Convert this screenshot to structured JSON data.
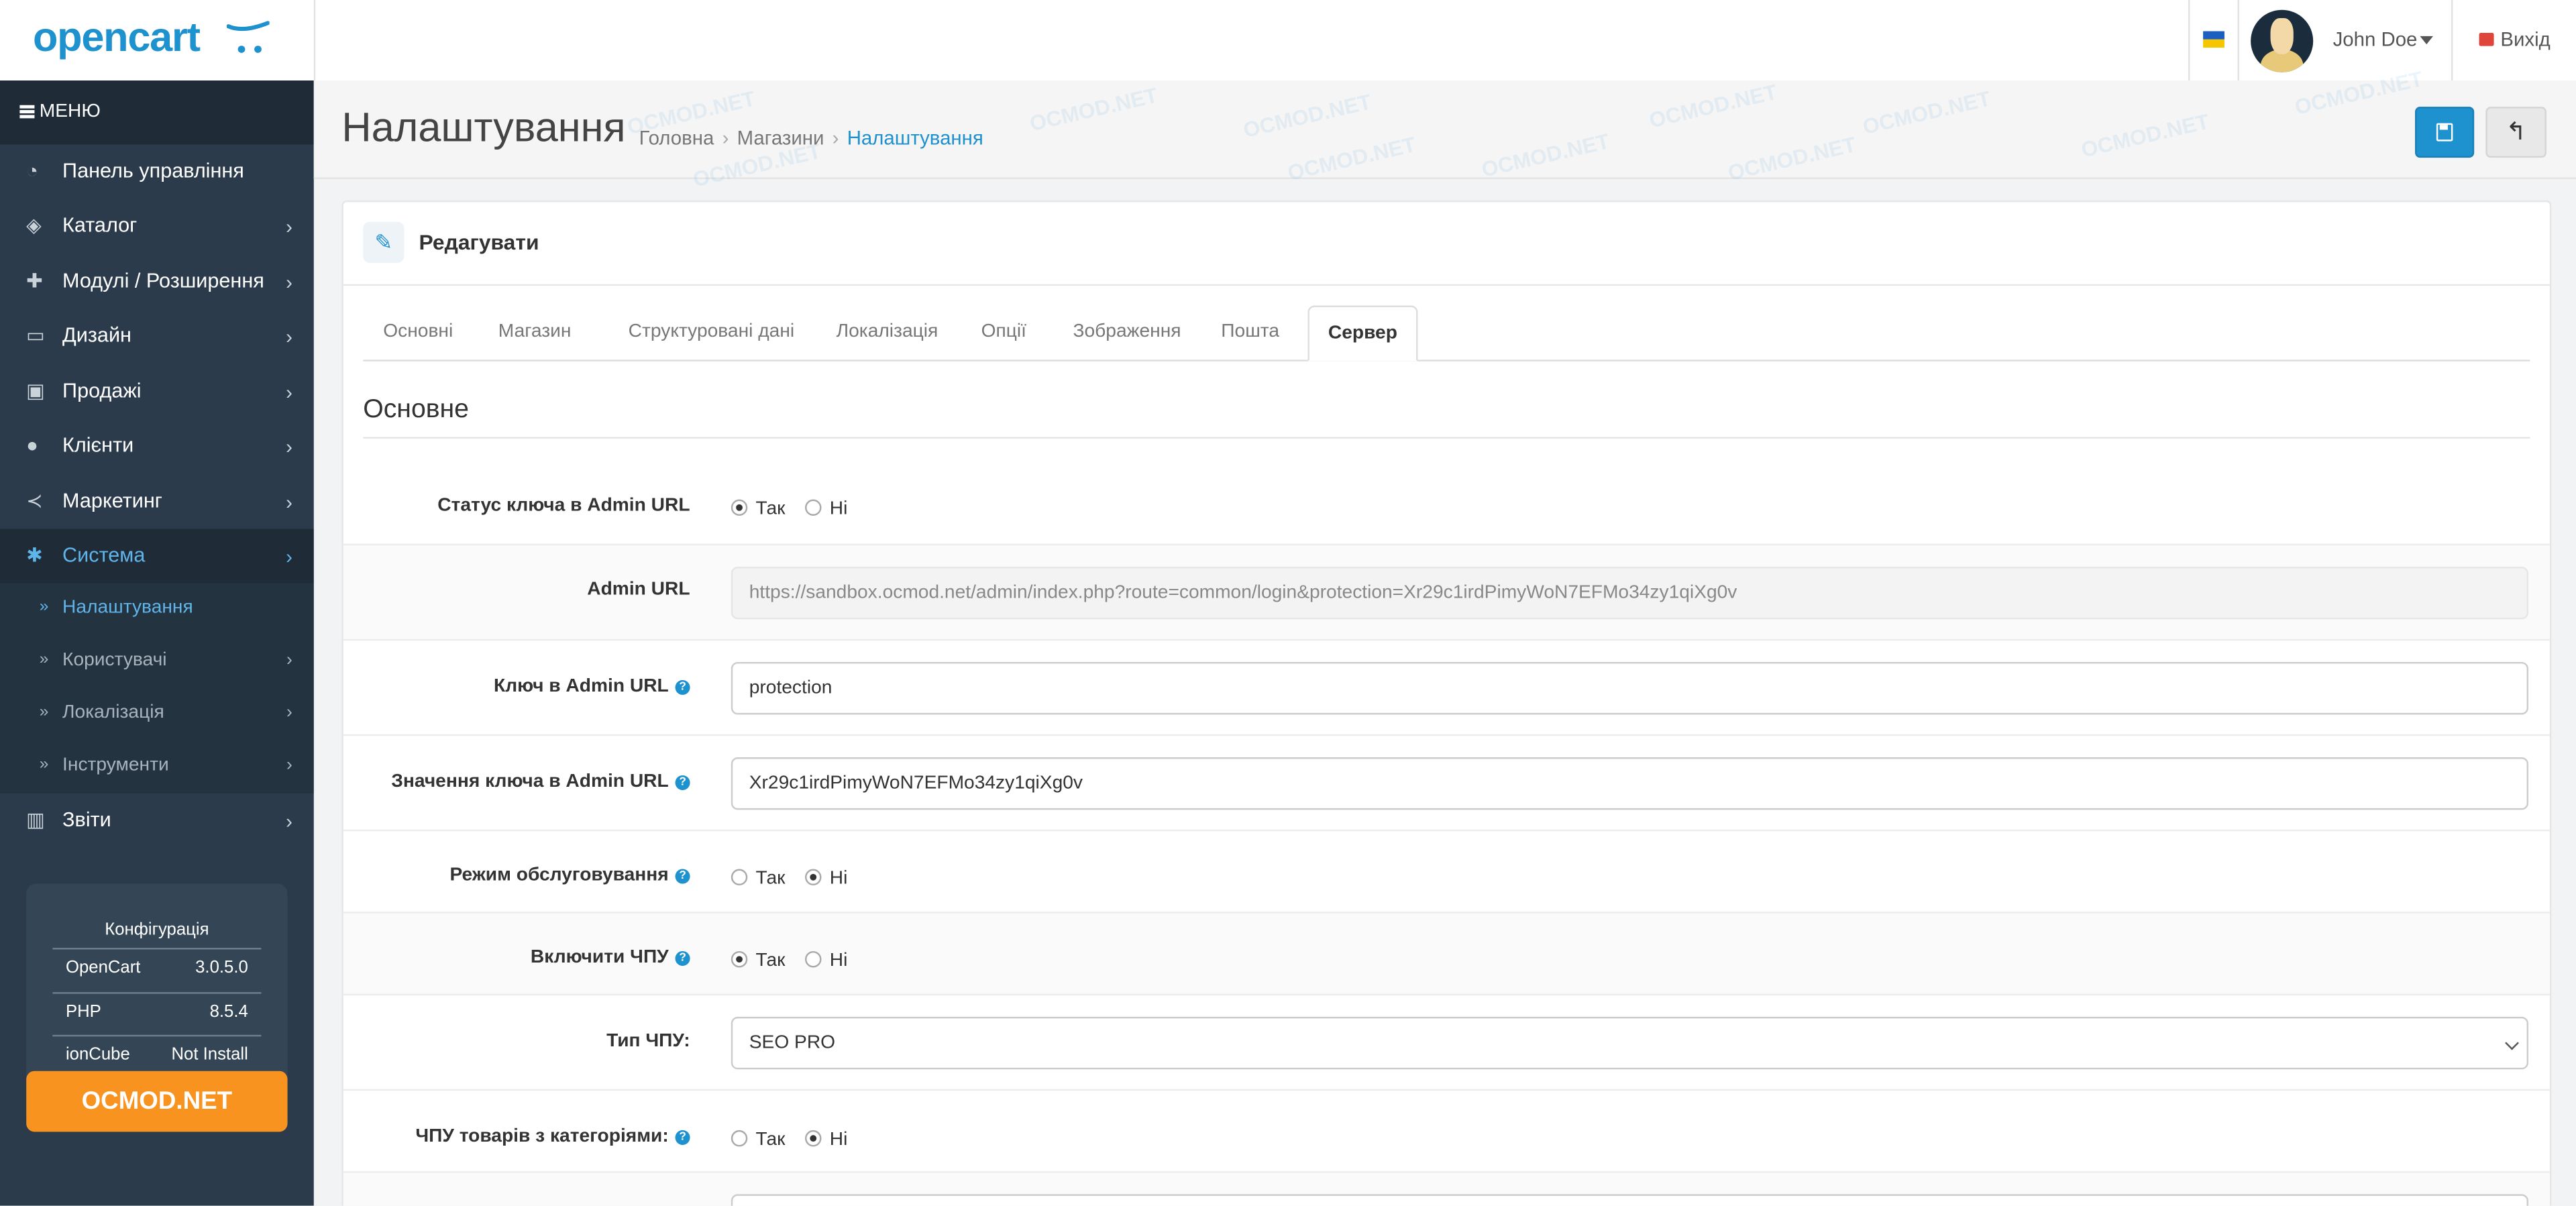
{
  "header": {
    "logo": "opencart",
    "user_name": "John Doe",
    "logout_label": "Вихід",
    "colors": {
      "brand": "#1e91cf",
      "logout_icon": "#e0453a"
    }
  },
  "sidebar": {
    "menu_label": "МЕНЮ",
    "items": [
      {
        "label": "Панель управління",
        "icon": "dashboard-icon"
      },
      {
        "label": "Каталог",
        "icon": "tags-icon"
      },
      {
        "label": "Модулі / Розширення",
        "icon": "puzzle-icon"
      },
      {
        "label": "Дизайн",
        "icon": "monitor-icon"
      },
      {
        "label": "Продажі",
        "icon": "cart-icon"
      },
      {
        "label": "Клієнти",
        "icon": "user-icon"
      },
      {
        "label": "Маркетинг",
        "icon": "share-icon"
      },
      {
        "label": "Система",
        "icon": "gear-icon"
      }
    ],
    "sub_items": [
      {
        "label": "Налаштування"
      },
      {
        "label": "Користувачі"
      },
      {
        "label": "Локалізація"
      },
      {
        "label": "Інструменти"
      }
    ],
    "reports": {
      "label": "Звіти",
      "icon": "bar-chart-icon"
    },
    "config": {
      "title": "Конфігурація",
      "rows": [
        {
          "key": "OpenCart",
          "value": "3.0.5.0"
        },
        {
          "key": "PHP",
          "value": "8.5.4"
        },
        {
          "key": "ionCube",
          "value": "Not Install"
        }
      ]
    },
    "promo_button": "OCMOD.NET",
    "colors": {
      "background": "#2b3b4b",
      "active": "#5fb4ea",
      "promo": "#f7931e"
    }
  },
  "page": {
    "title": "Налаштування",
    "breadcrumb": [
      "Головна",
      "Магазини",
      "Налаштування"
    ],
    "watermark": "OCMOD.NET"
  },
  "panel": {
    "title": "Редагувати",
    "tabs": [
      "Основні",
      "Магазин",
      "Структуровані дані",
      "Локалізація",
      "Опції",
      "Зображення",
      "Пошта",
      "Сервер"
    ],
    "active_tab": "Сервер",
    "legend": "Основне",
    "fields": {
      "admin_key_status": {
        "label": "Статус ключа в Admin URL",
        "yes": "Так",
        "no": "Ні",
        "value": "yes"
      },
      "admin_url": {
        "label": "Admin URL",
        "value": "https://sandbox.ocmod.net/admin/index.php?route=common/login&protection=Xr29c1irdPimyWoN7EFMo34zy1qiXg0v"
      },
      "admin_key": {
        "label": "Ключ в Admin URL",
        "value": "protection"
      },
      "admin_key_value": {
        "label": "Значення ключа в Admin URL",
        "value": "Xr29c1irdPimyWoN7EFMo34zy1qiXg0v"
      },
      "maintenance": {
        "label": "Режим обслуговування",
        "yes": "Так",
        "no": "Ні",
        "value": "no"
      },
      "seo_url": {
        "label": "Включити ЧПУ",
        "yes": "Так",
        "no": "Ні",
        "value": "yes"
      },
      "seo_type": {
        "label": "Тип ЧПУ:",
        "value": "SEO PRO"
      },
      "seo_categories": {
        "label": "ЧПУ товарів з категоріями:",
        "yes": "Так",
        "no": "Ні",
        "value": "no"
      }
    }
  }
}
